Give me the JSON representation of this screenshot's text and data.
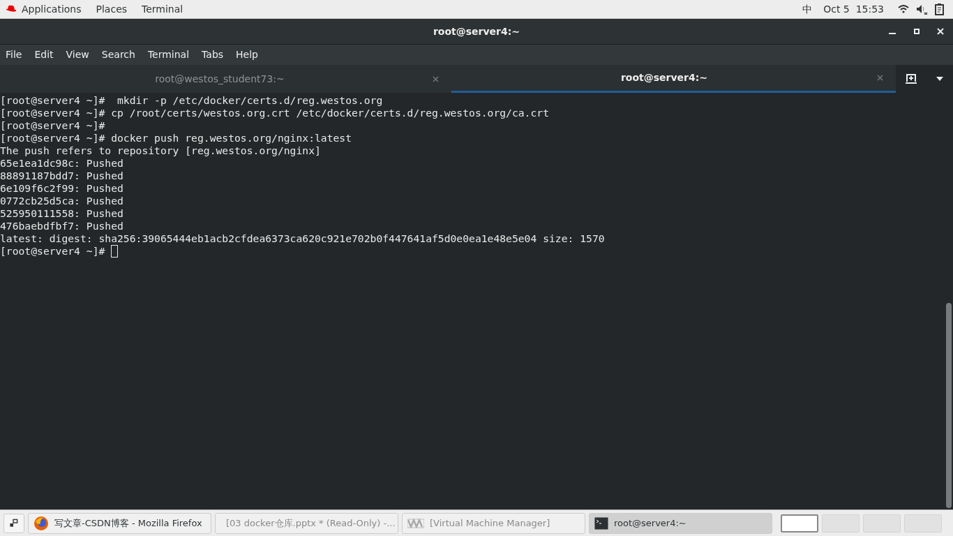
{
  "top_bar": {
    "menus": [
      "Applications",
      "Places",
      "Terminal"
    ],
    "input_method": "中",
    "clock": "Oct 5  15:53"
  },
  "window": {
    "title": "root@server4:~"
  },
  "menu_bar": [
    "File",
    "Edit",
    "View",
    "Search",
    "Terminal",
    "Tabs",
    "Help"
  ],
  "tabs": [
    {
      "label": "root@westos_student73:~",
      "selected": false
    },
    {
      "label": "root@server4:~",
      "selected": true
    }
  ],
  "terminal": {
    "lines": [
      "[root@server4 ~]#  mkdir -p /etc/docker/certs.d/reg.westos.org",
      "[root@server4 ~]# cp /root/certs/westos.org.crt /etc/docker/certs.d/reg.westos.org/ca.crt",
      "[root@server4 ~]# ",
      "[root@server4 ~]# docker push reg.westos.org/nginx:latest",
      "The push refers to repository [reg.westos.org/nginx]",
      "65e1ea1dc98c: Pushed",
      "88891187bdd7: Pushed",
      "6e109f6c2f99: Pushed",
      "0772cb25d5ca: Pushed",
      "525950111558: Pushed",
      "476baebdfbf7: Pushed",
      "latest: digest: sha256:39065444eb1acb2cfdea6373ca620c921e702b0f447641af5d0e0ea1e48e5e04 size: 1570"
    ],
    "prompt": "[root@server4 ~]# "
  },
  "taskbar": {
    "items": [
      {
        "kind": "firefox",
        "label": "写文章-CSDN博客 - Mozilla Firefox",
        "selected": false
      },
      {
        "kind": "slides",
        "label": "[03 docker仓库.pptx * (Read-Only) -...",
        "selected": false
      },
      {
        "kind": "vm",
        "label": "[Virtual Machine Manager]",
        "selected": false
      },
      {
        "kind": "terminal",
        "label": "root@server4:~",
        "selected": true
      }
    ],
    "workspaces": [
      {
        "selected": true
      },
      {
        "selected": false
      },
      {
        "selected": false
      },
      {
        "selected": false
      }
    ]
  }
}
